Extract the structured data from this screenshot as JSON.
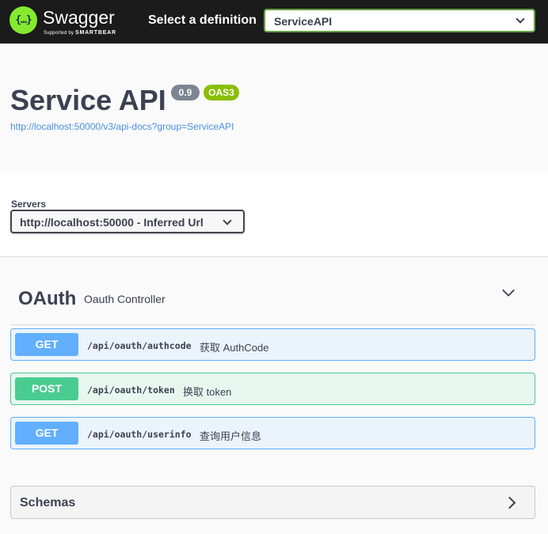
{
  "topbar": {
    "logo_text": "Swagger",
    "logo_icon_glyph": "{…}",
    "logo_sub_prefix": "Supported by ",
    "logo_sub_brand": "SMARTBEAR",
    "definition_label": "Select a definition",
    "definition_value": "ServiceAPI"
  },
  "info": {
    "title": "Service API",
    "version": "0.9",
    "oas": "OAS3",
    "url": "http://localhost:50000/v3/api-docs?group=ServiceAPI"
  },
  "servers": {
    "label": "Servers",
    "selected": "http://localhost:50000 - Inferred Url"
  },
  "tag": {
    "name": "OAuth",
    "description": "Oauth Controller",
    "operations": [
      {
        "method": "GET",
        "path": "/api/oauth/authcode",
        "summary": "获取 AuthCode"
      },
      {
        "method": "POST",
        "path": "/api/oauth/token",
        "summary": "换取 token"
      },
      {
        "method": "GET",
        "path": "/api/oauth/userinfo",
        "summary": "查询用户信息"
      }
    ]
  },
  "schemas": {
    "title": "Schemas"
  },
  "colors": {
    "topbar_bg": "#1b1b1b",
    "logo_green": "#85ea2d",
    "definition_border": "#62a03f",
    "get": "#61affe",
    "post": "#49cc90",
    "version_badge": "#7d8492",
    "oas_badge": "#89bf04",
    "link": "#4990e2"
  },
  "icons": {
    "definition_dropdown": "chevron-down-icon",
    "server_dropdown": "chevron-down-icon",
    "tag_toggle": "chevron-down-icon",
    "schemas_toggle": "chevron-right-icon"
  }
}
